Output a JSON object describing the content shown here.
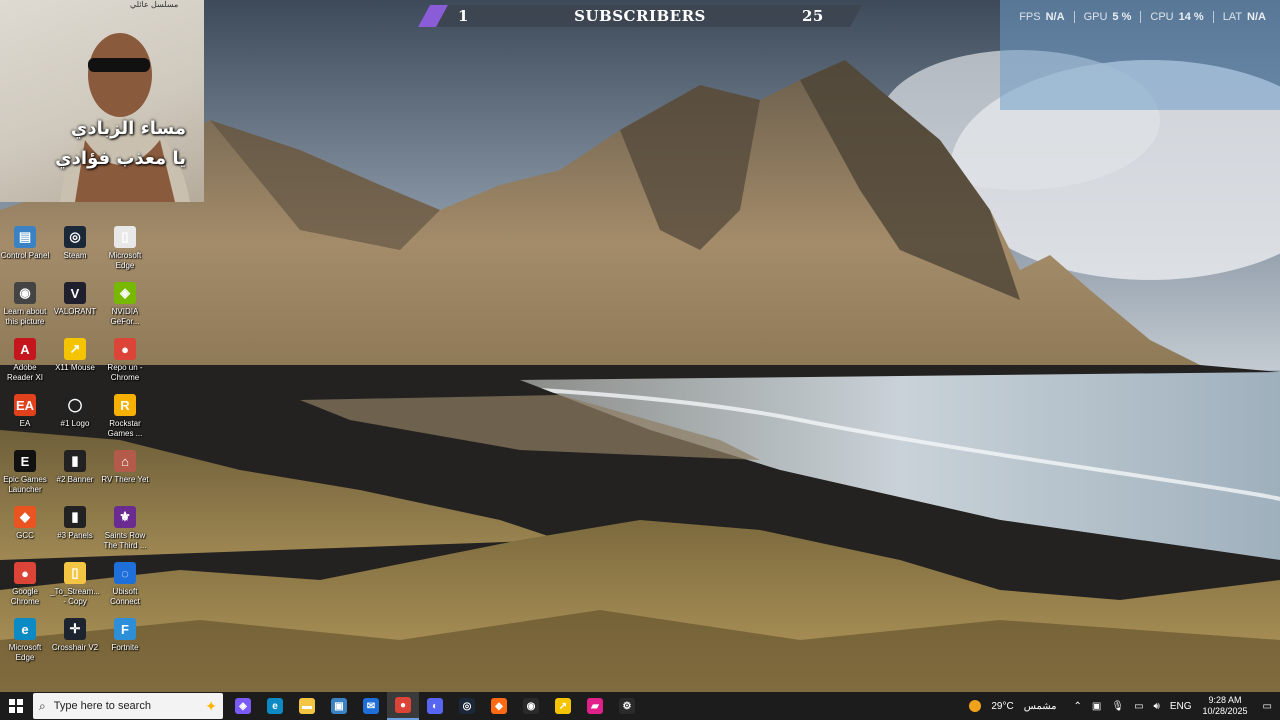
{
  "overlay": {
    "subscribers": {
      "left_value": "1",
      "title": "SUBSCRIBERS",
      "right_value": "25"
    },
    "perf": [
      {
        "label": "FPS",
        "value": "N/A"
      },
      {
        "label": "GPU",
        "value": "5 %"
      },
      {
        "label": "CPU",
        "value": "14 %"
      },
      {
        "label": "LAT",
        "value": "N/A"
      }
    ]
  },
  "webcam": {
    "caption": "مسلسل عائلي",
    "line1": "مساء الزبادي",
    "line2": "يا معذب فؤادي"
  },
  "desktop_icons": [
    {
      "label": "Control Panel",
      "icon": "control-panel-icon",
      "color": "#3b82c4",
      "glyph": "▤"
    },
    {
      "label": "Steam",
      "icon": "steam-icon",
      "color": "#1b2838",
      "glyph": "◎"
    },
    {
      "label": "Microsoft Edge",
      "icon": "file-icon",
      "color": "#e8e8e8",
      "glyph": "▯"
    },
    {
      "label": "Learn about this picture",
      "icon": "camera-icon",
      "color": "#444",
      "glyph": "◉"
    },
    {
      "label": "VALORANT",
      "icon": "valorant-icon",
      "color": "#1f1f2e",
      "glyph": "V"
    },
    {
      "label": "NVIDIA GeFor...",
      "icon": "nvidia-icon",
      "color": "#76b900",
      "glyph": "◈"
    },
    {
      "label": "Adobe Reader XI",
      "icon": "adobe-reader-icon",
      "color": "#c4161c",
      "glyph": "A"
    },
    {
      "label": "X11 Mouse",
      "icon": "x11-mouse-icon",
      "color": "#f5c400",
      "glyph": "↗"
    },
    {
      "label": "Repo un - Chrome",
      "icon": "chrome-icon",
      "color": "#db4437",
      "glyph": "●"
    },
    {
      "label": "EA",
      "icon": "ea-icon",
      "color": "#e2421b",
      "glyph": "EA"
    },
    {
      "label": "#1 Logo",
      "icon": "logo-file-icon",
      "color": "#222",
      "glyph": "◯"
    },
    {
      "label": "Rockstar Games ...",
      "icon": "rockstar-icon",
      "color": "#f6b100",
      "glyph": "R"
    },
    {
      "label": "Epic Games Launcher",
      "icon": "epic-games-icon",
      "color": "#111",
      "glyph": "E"
    },
    {
      "label": "#2 Banner",
      "icon": "banner-file-icon",
      "color": "#222",
      "glyph": "▮"
    },
    {
      "label": "RV There Yet",
      "icon": "rv-there-yet-icon",
      "color": "#b45a4a",
      "glyph": "⌂"
    },
    {
      "label": "GCC",
      "icon": "gcc-icon",
      "color": "#e95420",
      "glyph": "◆"
    },
    {
      "label": "#3 Panels",
      "icon": "panels-file-icon",
      "color": "#222",
      "glyph": "▮"
    },
    {
      "label": "Saints Row The Third ...",
      "icon": "saints-row-icon",
      "color": "#6b2c91",
      "glyph": "⚜"
    },
    {
      "label": "Google Chrome",
      "icon": "google-chrome-icon",
      "color": "#db4437",
      "glyph": "●"
    },
    {
      "label": "_To_Stream... - Copy",
      "icon": "folder-icon",
      "color": "#f4c542",
      "glyph": "▯"
    },
    {
      "label": "Ubisoft Connect",
      "icon": "ubisoft-icon",
      "color": "#1f6fdb",
      "glyph": "◌"
    },
    {
      "label": "Microsoft Edge",
      "icon": "edge-icon",
      "color": "#0c8ac4",
      "glyph": "e"
    },
    {
      "label": "Crosshair V2",
      "icon": "crosshair-icon",
      "color": "#1e2330",
      "glyph": "✛"
    },
    {
      "label": "Fortnite",
      "icon": "fortnite-icon",
      "color": "#2d8fd8",
      "glyph": "F"
    }
  ],
  "taskbar": {
    "search_placeholder": "Type here to search",
    "apps": [
      {
        "name": "copilot-icon",
        "color": "#7a5af8",
        "glyph": "◈",
        "active": false
      },
      {
        "name": "edge-icon",
        "color": "#0c8ac4",
        "glyph": "e",
        "active": false
      },
      {
        "name": "file-explorer-icon",
        "color": "#f4c542",
        "glyph": "▬",
        "active": false
      },
      {
        "name": "store-icon",
        "color": "#3b82c4",
        "glyph": "▣",
        "active": false
      },
      {
        "name": "mail-icon",
        "color": "#1e6fd8",
        "glyph": "✉",
        "active": false
      },
      {
        "name": "chrome-icon",
        "color": "#db4437",
        "glyph": "●",
        "active": true
      },
      {
        "name": "discord-icon",
        "color": "#5865f2",
        "glyph": "◐",
        "active": false
      },
      {
        "name": "steam-icon",
        "color": "#1b2838",
        "glyph": "◎",
        "active": false
      },
      {
        "name": "orange-app-icon",
        "color": "#ff6a13",
        "glyph": "◆",
        "active": false
      },
      {
        "name": "record-app-icon",
        "color": "#2a2a2a",
        "glyph": "◉",
        "active": false
      },
      {
        "name": "x11-mouse-icon",
        "color": "#f5c400",
        "glyph": "↗",
        "active": false
      },
      {
        "name": "pink-app-icon",
        "color": "#e0218a",
        "glyph": "▰",
        "active": false
      },
      {
        "name": "obs-settings-icon",
        "color": "#2a2a2a",
        "glyph": "⚙",
        "active": false
      }
    ],
    "weather_temp": "29°C",
    "weather_desc": "مشمس",
    "language": "ENG",
    "time": "9:28 AM",
    "date": "10/28/2025"
  }
}
